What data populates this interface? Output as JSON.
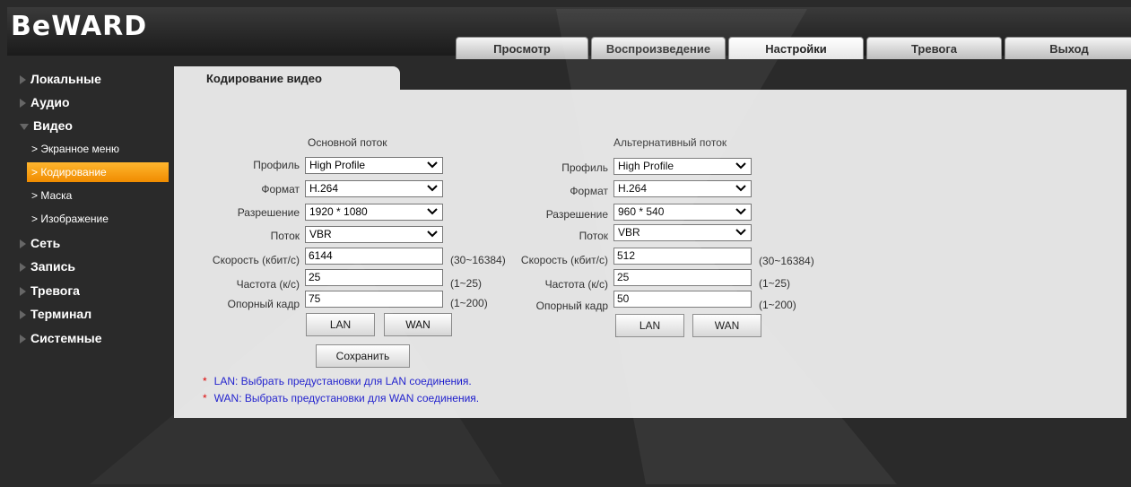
{
  "header": {
    "logo_text": "BeWARD"
  },
  "tabs": [
    {
      "label": "Просмотр",
      "active": false
    },
    {
      "label": "Воспроизведение",
      "active": false
    },
    {
      "label": "Настройки",
      "active": true
    },
    {
      "label": "Тревога",
      "active": false
    },
    {
      "label": "Выход",
      "active": false
    }
  ],
  "sidebar": {
    "categories": [
      "Локальные",
      "Аудио",
      "Видео"
    ],
    "video_subitems": [
      "Экранное меню",
      "Кодирование",
      "Маска",
      "Изображение"
    ],
    "active_subitem": "Кодирование",
    "rest_categories": [
      "Сеть",
      "Запись",
      "Тревога",
      "Терминал",
      "Системные"
    ]
  },
  "content": {
    "tab_title": "Кодирование видео",
    "labels": {
      "profile": "Профиль",
      "format": "Формат",
      "resolution": "Разрешение",
      "stream": "Поток",
      "bitrate": "Скорость (кбит/с)",
      "framerate": "Частота (к/с)",
      "keyframe": "Опорный кадр"
    },
    "main": {
      "title": "Основной поток",
      "profile": "High Profile",
      "format": "H.264",
      "resolution": "1920 * 1080",
      "stream": "VBR",
      "bitrate": "6144",
      "bitrate_range": "(30~16384)",
      "framerate": "25",
      "framerate_range": "(1~25)",
      "keyframe": "75",
      "keyframe_range": "(1~200)",
      "lan_label": "LAN",
      "wan_label": "WAN"
    },
    "alt": {
      "title": "Альтернативный поток",
      "profile": "High Profile",
      "format": "H.264",
      "resolution": "960 * 540",
      "stream": "VBR",
      "bitrate": "512",
      "bitrate_range": "(30~16384)",
      "framerate": "25",
      "framerate_range": "(1~25)",
      "keyframe": "50",
      "keyframe_range": "(1~200)",
      "lan_label": "LAN",
      "wan_label": "WAN"
    },
    "save_label": "Сохранить",
    "notes": [
      "LAN: Выбрать предустановки для LAN соединения.",
      "WAN: Выбрать предустановки для WAN соединения."
    ],
    "note_marker": "*"
  },
  "colors": {
    "accent": "#f39a12",
    "panel": "#e3e3e3",
    "background": "#2a2a2a",
    "note_text": "#1a1acc"
  }
}
